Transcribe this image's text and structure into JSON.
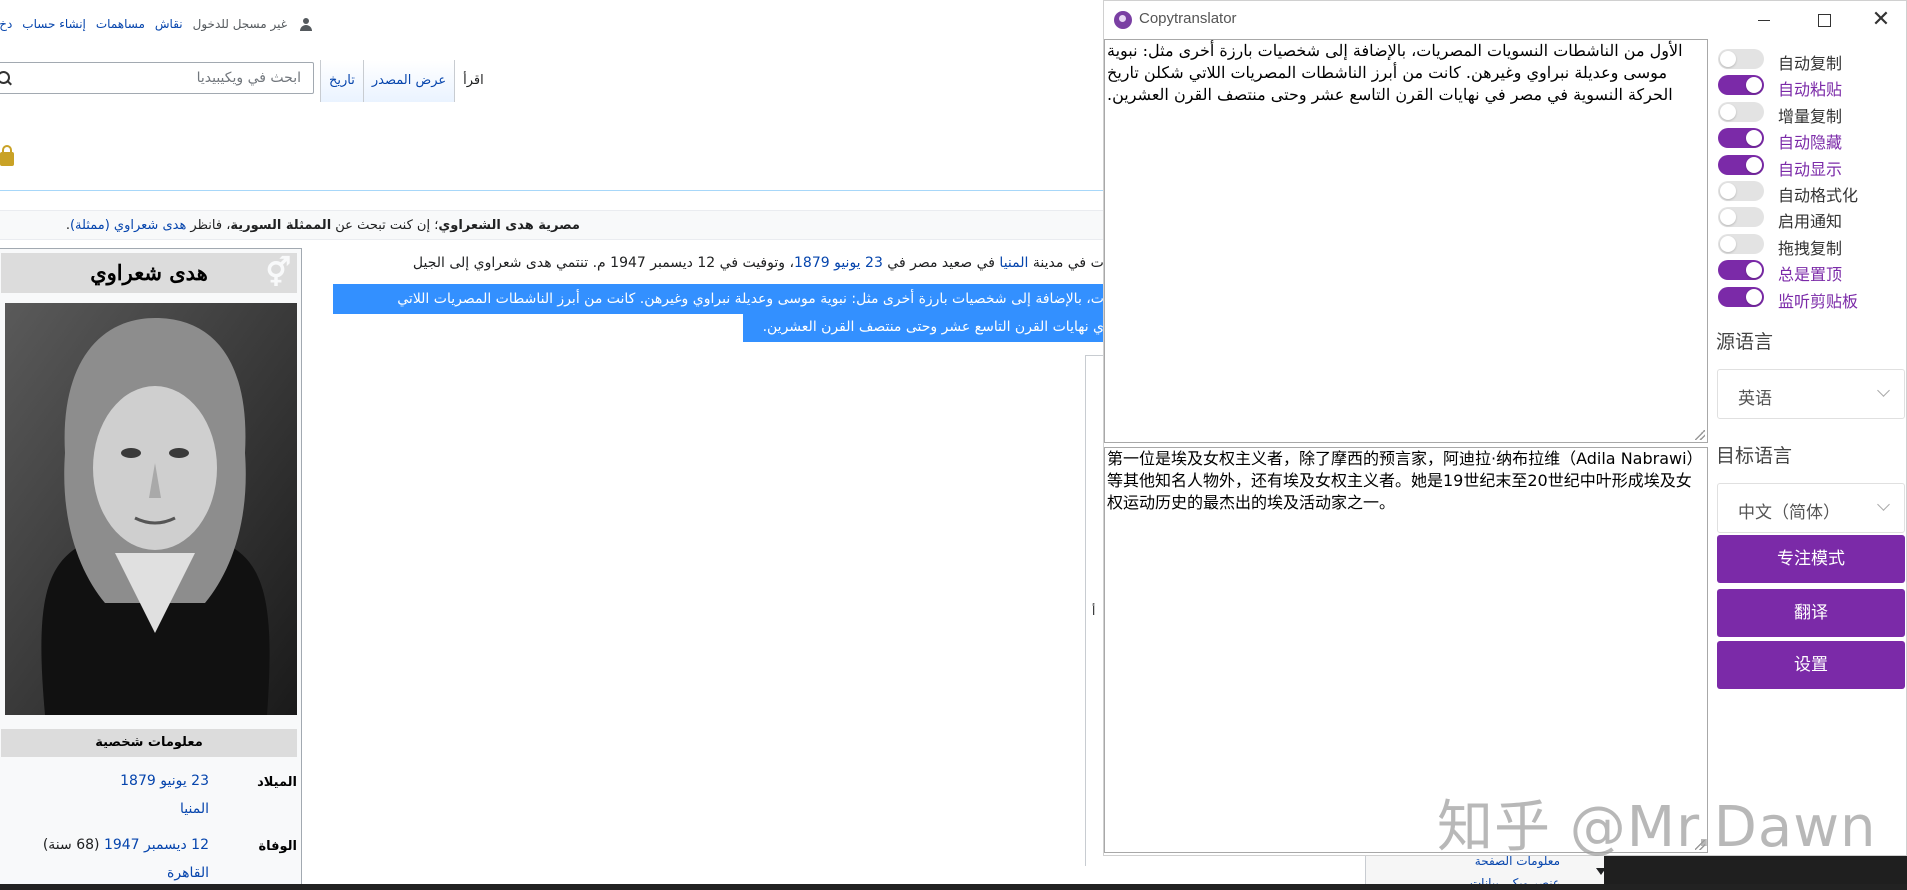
{
  "wiki": {
    "personal": {
      "anon": "غير مسجل للدخول",
      "talk": "نقاش",
      "contribs": "مساهمات",
      "create": "إنشاء حساب",
      "login": "دخ"
    },
    "tabs": [
      "اقرأ",
      "عرض المصدر",
      "تاريخ"
    ],
    "search_placeholder": "ابحث في ويكيبيديا",
    "hatnote_bold": "مصرية هدى الشعراوي",
    "hatnote_mid": "؛ إن كنت تبحث عن ",
    "hatnote_bold2": "الممثلة السورية",
    "hatnote_end": "، فانظر ",
    "hatnote_link": "هدى شعراوي (ممثلة)",
    "para1_a": "دت في مدينة ",
    "para1_link1": "المنيا",
    "para1_b": " في صعيد مصر في ",
    "para1_link2": "23 يونيو",
    "para1_link3": "1879",
    "para1_c": "، وتوفيت في 12 ديسمبر 1947 م. تنتمي هدى شعراوي إلى الجيل",
    "sel_line1": "ت، بالإضافة إلى شخصيات بارزة أخرى مثل: نبوية موسى وعديلة نبراوي وغيرهن. كانت من أبرز الناشطات المصريات اللاتي",
    "sel_line2": "ي نهايات القرن التاسع عشر وحتى منتصف القرن العشرين.",
    "infobox": {
      "title": "هدى شعراوي",
      "section": "معلومات شخصية",
      "birth_label": "الميلاد",
      "birth_date": "23 يونيو 1879",
      "birth_place": "المنيا",
      "death_label": "الوفاة",
      "death_date": "12 ديسمبر 1947",
      "death_age": "(68 سنة)",
      "death_place": "القاهرة"
    },
    "tiny_letter": "أ",
    "sidebar_link": "معلومات الصفحة",
    "sidebar_link2": "عنصر ويكي بيانات"
  },
  "translator": {
    "title": "Copytranslator",
    "source_text": "الأول من الناشطات النسويات المصريات، بالإضافة إلى شخصيات بارزة أخرى مثل: نبوية موسى وعديلة نبراوي وغيرهن. كانت من أبرز الناشطات المصريات اللاتي شكلن تاريخ الحركة النسوية في مصر في نهايات القرن التاسع عشر وحتى منتصف القرن العشرين.",
    "result_text": "第一位是埃及女权主义者，除了摩西的预言家，阿迪拉·纳布拉维（Adila Nabrawi）等其他知名人物外，还有埃及女权主义者。她是19世纪末至20世纪中叶形成埃及女权运动历史的最杰出的埃及活动家之一。",
    "toggles": [
      {
        "label": "自动复制",
        "on": false
      },
      {
        "label": "自动粘贴",
        "on": true
      },
      {
        "label": "增量复制",
        "on": false
      },
      {
        "label": "自动隐藏",
        "on": true
      },
      {
        "label": "自动显示",
        "on": true
      },
      {
        "label": "自动格式化",
        "on": false
      },
      {
        "label": "启用通知",
        "on": false
      },
      {
        "label": "拖拽复制",
        "on": false
      },
      {
        "label": "总是置顶",
        "on": true
      },
      {
        "label": "监听剪贴板",
        "on": true
      }
    ],
    "source_lang_label": "源语言",
    "source_lang": "英语",
    "target_lang_label": "目标语言",
    "target_lang": "中文（简体）",
    "focus_button": "专注模式",
    "translate_button": "翻译",
    "settings_button": "设置",
    "accent_color": "#7b2aa8"
  },
  "watermark": "知乎 @Mr.Dawn"
}
